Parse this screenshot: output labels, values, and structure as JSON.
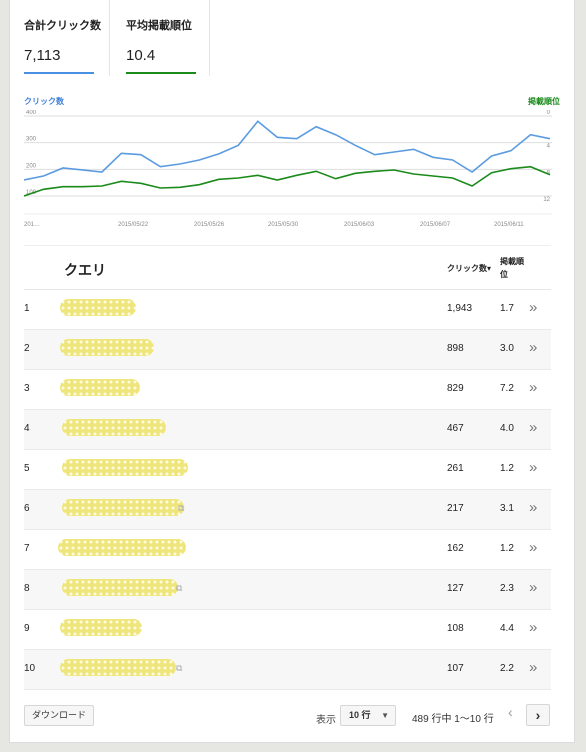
{
  "metrics": [
    {
      "label": "合計クリック数",
      "value": "7,113",
      "color": "#4a90e2"
    },
    {
      "label": "平均掲載順位",
      "value": "10.4",
      "color": "#1a8a1a"
    }
  ],
  "chart_data": {
    "type": "line",
    "title": "",
    "legend_left": "クリック数",
    "legend_right": "掲載順位",
    "x_tick_labels": [
      "201…",
      "2015/05/22",
      "2015/05/26",
      "2015/05/30",
      "2015/06/03",
      "2015/06/07",
      "2015/06/11"
    ],
    "y_left_ticks": [
      "400",
      "300",
      "200",
      "100"
    ],
    "y_right_ticks": [
      "0",
      "4",
      "8",
      "12"
    ],
    "y_left_range": [
      100,
      400
    ],
    "y_right_range": [
      12,
      0
    ],
    "grid": true,
    "series": [
      {
        "name": "クリック数",
        "color": "#5b9be0",
        "axis": "left",
        "values": [
          160,
          175,
          205,
          198,
          190,
          260,
          255,
          210,
          220,
          235,
          258,
          290,
          380,
          320,
          315,
          360,
          330,
          290,
          255,
          265,
          275,
          245,
          235,
          190,
          250,
          270,
          330,
          315
        ]
      },
      {
        "name": "掲載順位",
        "color": "#1a8a1a",
        "axis": "right",
        "values": [
          12.0,
          11.0,
          10.6,
          10.6,
          10.5,
          9.8,
          10.1,
          10.8,
          10.7,
          10.3,
          9.5,
          9.3,
          8.9,
          9.6,
          8.9,
          8.3,
          9.4,
          8.6,
          8.3,
          8.1,
          8.7,
          9.0,
          9.3,
          10.5,
          8.5,
          7.9,
          7.6,
          8.8
        ]
      }
    ]
  },
  "table": {
    "col_query": "クエリ",
    "col_clicks": "クリック数▾",
    "col_position": "掲載順位",
    "rows": [
      {
        "rank": "1",
        "clicks": "1,943",
        "position": "1.7"
      },
      {
        "rank": "2",
        "clicks": "898",
        "position": "3.0"
      },
      {
        "rank": "3",
        "clicks": "829",
        "position": "7.2"
      },
      {
        "rank": "4",
        "clicks": "467",
        "position": "4.0"
      },
      {
        "rank": "5",
        "clicks": "261",
        "position": "1.2"
      },
      {
        "rank": "6",
        "clicks": "217",
        "position": "3.1"
      },
      {
        "rank": "7",
        "clicks": "162",
        "position": "1.2"
      },
      {
        "rank": "8",
        "clicks": "127",
        "position": "2.3"
      },
      {
        "rank": "9",
        "clicks": "108",
        "position": "4.4"
      },
      {
        "rank": "10",
        "clicks": "107",
        "position": "2.2"
      }
    ],
    "row_action_icon": "»",
    "external_link_icon": "⧉"
  },
  "footer": {
    "download_label": "ダウンロード",
    "show_label": "表示",
    "rows_per_page": "10 行",
    "range_text": "489 行中 1〜10 行",
    "prev_icon": "‹",
    "next_icon": "›"
  }
}
